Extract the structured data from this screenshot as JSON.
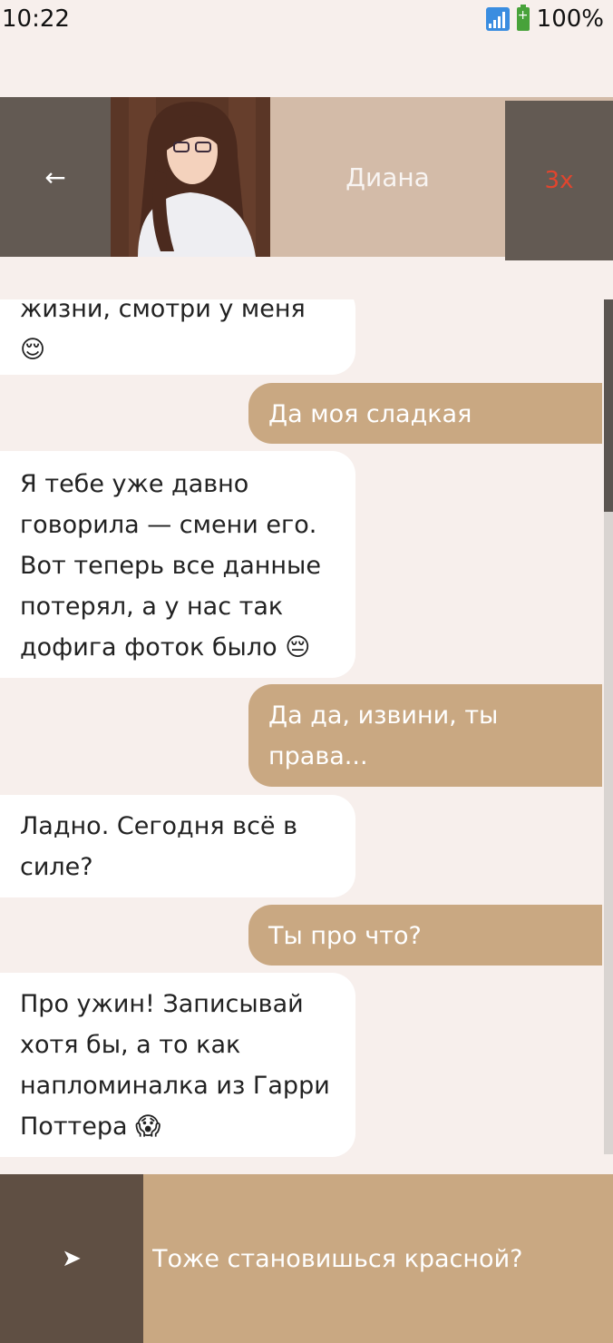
{
  "status_bar": {
    "time": "10:22",
    "battery": "100%"
  },
  "header": {
    "back_label": "←",
    "contact_name": "Диана",
    "speed_label": "3x"
  },
  "messages": [
    {
      "from": "contact",
      "text": "жизни, смотри у меня 😌"
    },
    {
      "from": "me",
      "text": "Да моя сладкая"
    },
    {
      "from": "contact",
      "text": "Я тебе уже давно говорила — смени его. Вот теперь все данные потерял, а у нас так дофига фоток было 😔"
    },
    {
      "from": "me",
      "text": "Да да, извини, ты права..."
    },
    {
      "from": "contact",
      "text": "Ладно. Сегодня всё в силе?"
    },
    {
      "from": "me",
      "text": "Ты про что?"
    },
    {
      "from": "contact",
      "text": "Про ужин! Записывай хотя бы, а то как напломиналка из Гарри Поттера 😱"
    }
  ],
  "composer": {
    "send_label": "➤",
    "input_value": "Тоже становишься красной?"
  }
}
